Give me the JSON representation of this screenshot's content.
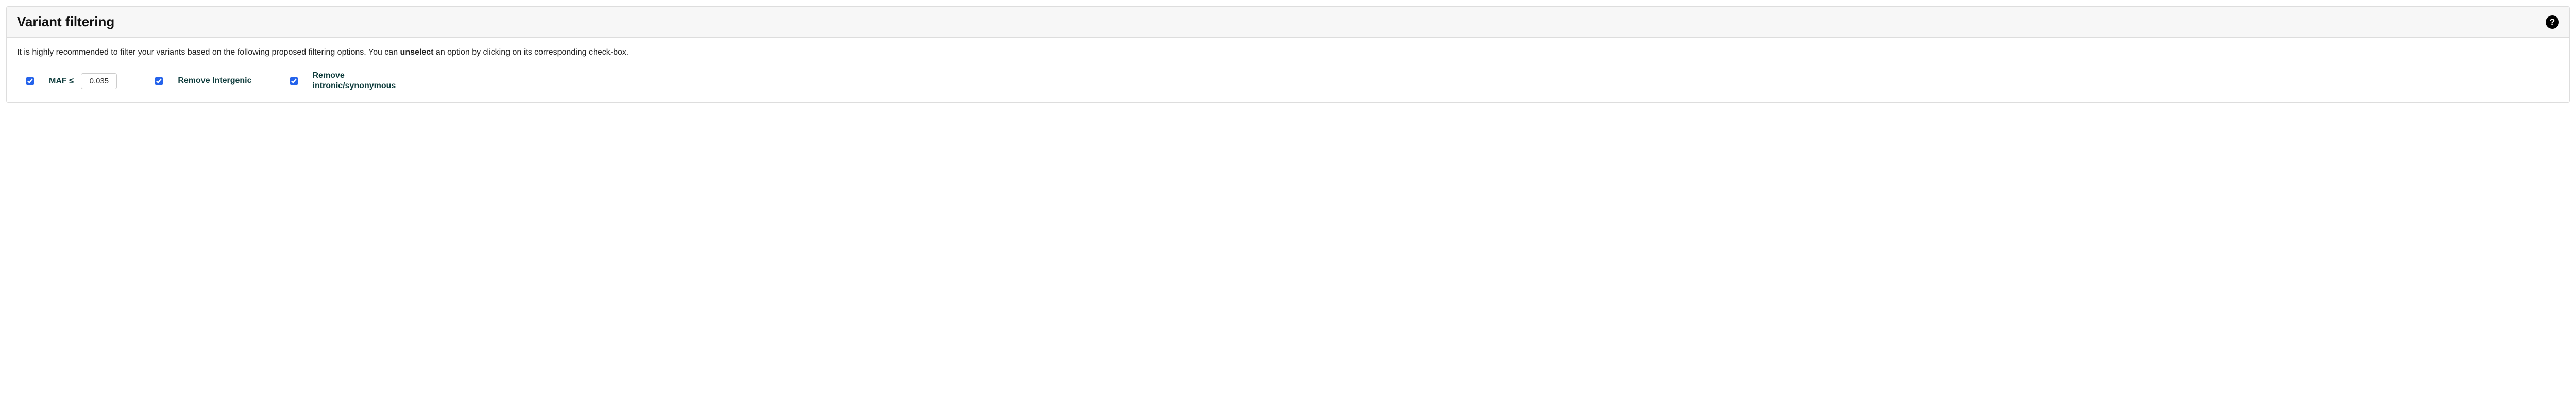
{
  "panel": {
    "title": "Variant filtering",
    "help_icon": "?",
    "description_pre": "It is highly recommended to filter your variants based on the following proposed filtering options. You can ",
    "description_bold": "unselect",
    "description_post": " an option by clicking on its corresponding check-box."
  },
  "filters": {
    "maf": {
      "checked": true,
      "label": "MAF ≤",
      "value": "0.035"
    },
    "intergenic": {
      "checked": true,
      "label": "Remove Intergenic"
    },
    "intronic": {
      "checked": true,
      "label_line1": "Remove",
      "label_line2": "intronic/synonymous"
    }
  }
}
